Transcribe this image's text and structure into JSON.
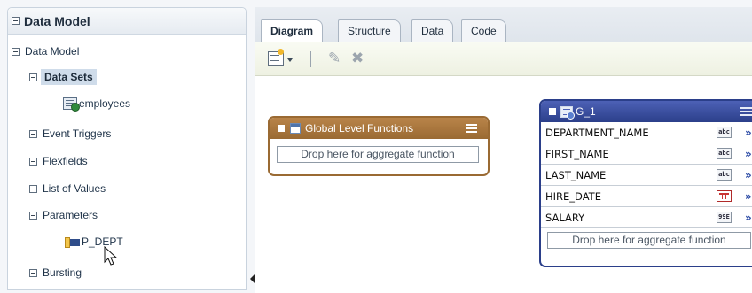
{
  "left_panel": {
    "title": "Data Model",
    "tree": {
      "root": "Data Model",
      "data_sets": "Data Sets",
      "employees": "employees",
      "event_triggers": "Event Triggers",
      "flexfields": "Flexfields",
      "list_of_values": "List of Values",
      "parameters": "Parameters",
      "p_dept": "P_DEPT",
      "bursting": "Bursting"
    }
  },
  "tabs": [
    "Diagram",
    "Structure",
    "Data",
    "Code"
  ],
  "active_tab": "Diagram",
  "toolbar": {
    "new_icon": "new-data-set-icon",
    "edit_icon": "pencil-icon",
    "delete_icon": "delete-x-icon"
  },
  "canvas": {
    "global_functions": {
      "title": "Global Level Functions",
      "drop_text": "Drop here for aggregate function"
    },
    "group": {
      "title": "G_1",
      "columns": [
        {
          "name": "DEPARTMENT_NAME",
          "type": "abc"
        },
        {
          "name": "FIRST_NAME",
          "type": "abc"
        },
        {
          "name": "LAST_NAME",
          "type": "abc"
        },
        {
          "name": "HIRE_DATE",
          "type": "date"
        },
        {
          "name": "SALARY",
          "type": "99E"
        }
      ],
      "more_glyph": "»",
      "drop_text": "Drop here for aggregate function"
    }
  },
  "colors": {
    "global_functions_header": "#9a6a33",
    "group_header": "#2b3f8a",
    "selected_item": "#cfdcea"
  }
}
